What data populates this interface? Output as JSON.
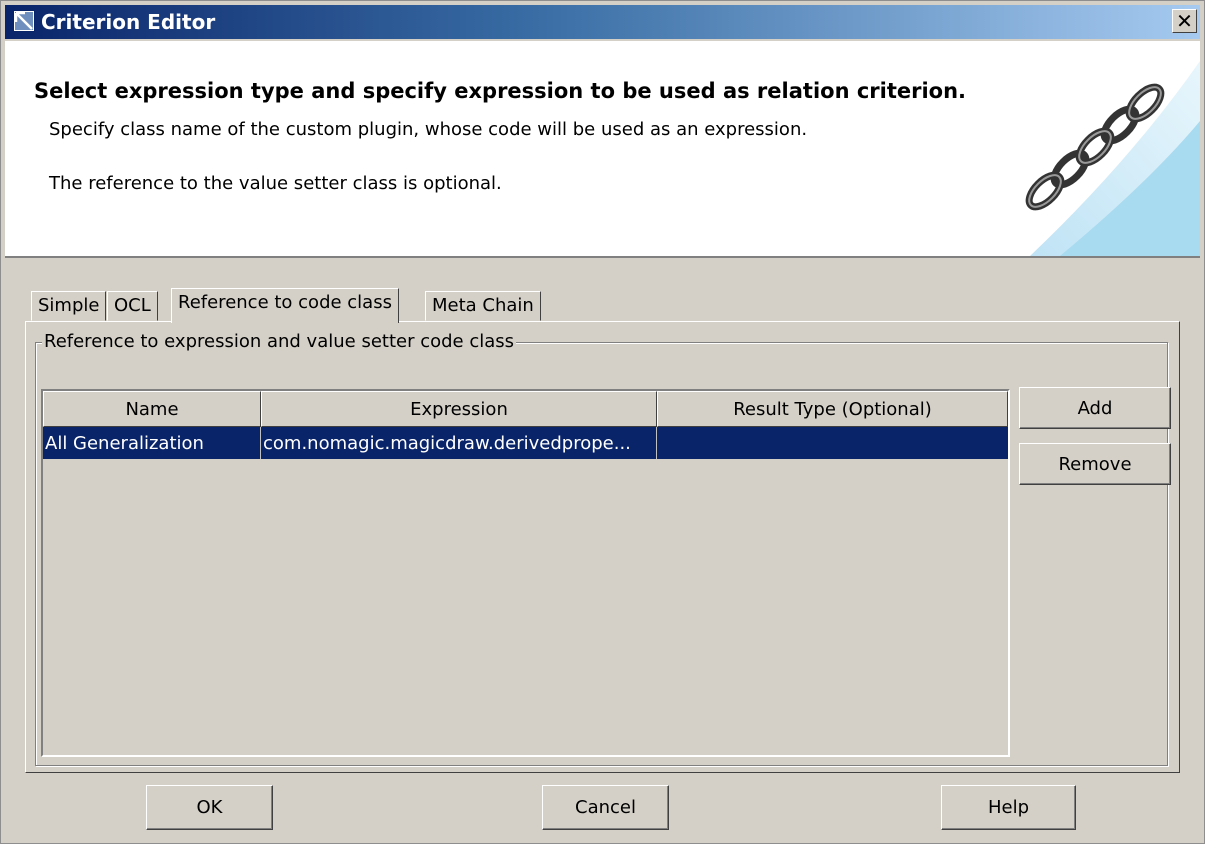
{
  "window": {
    "title": "Criterion Editor",
    "close_glyph": "✕"
  },
  "banner": {
    "heading": "Select expression type and specify expression to be used as relation criterion.",
    "line1": "Specify class name of the custom plugin, whose code will be used as an expression.",
    "line2": "The reference to the value setter class is optional.",
    "art_icon": "chain-links-icon"
  },
  "tabs": [
    {
      "label": "Simple",
      "active": false
    },
    {
      "label": "OCL",
      "active": false
    },
    {
      "label": "Reference to code class",
      "active": true
    },
    {
      "label": "Meta Chain",
      "active": false
    }
  ],
  "group": {
    "legend": "Reference to expression and value setter code class"
  },
  "table": {
    "columns": [
      "Name",
      "Expression",
      "Result Type (Optional)"
    ],
    "rows": [
      {
        "name": "All Generalization",
        "expression": "com.nomagic.magicdraw.derivedprope...",
        "result_type": "",
        "selected": true
      }
    ]
  },
  "side_buttons": {
    "add": "Add",
    "remove": "Remove"
  },
  "footer": {
    "ok": "OK",
    "cancel": "Cancel",
    "help": "Help"
  },
  "colors": {
    "title_start": "#0a246a",
    "title_end": "#a6caf0",
    "selection": "#0a246a",
    "dialog_bg": "#d4d0c8"
  }
}
